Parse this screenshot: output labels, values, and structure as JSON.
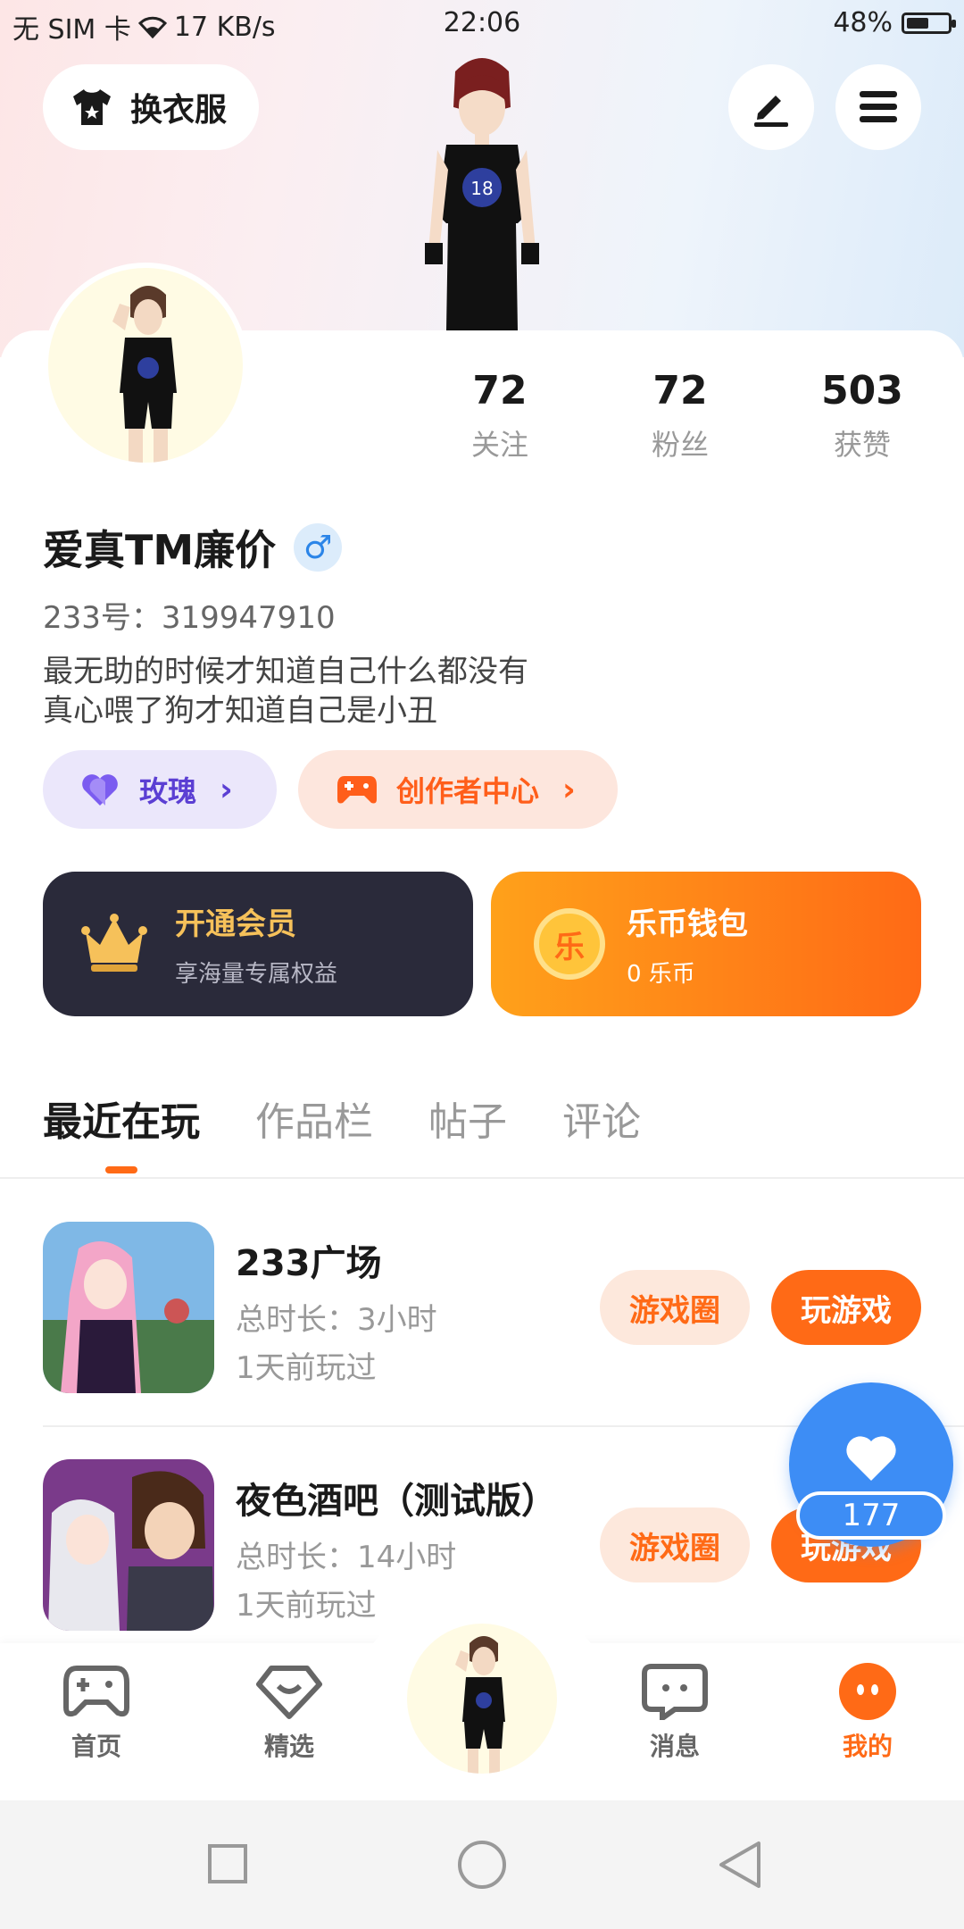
{
  "status_bar": {
    "carrier": "无 SIM 卡",
    "speed": "17 KB/s",
    "time": "22:06",
    "battery": "48%",
    "battery_level": 0.48
  },
  "header": {
    "outfit_label": "换衣服",
    "edit_icon": "pen-icon",
    "menu_icon": "menu-icon"
  },
  "profile": {
    "username": "爱真TM廉价",
    "gender_symbol": "♂",
    "uid": "233号：319947910",
    "bio_line1": "最无助的时候才知道自己什么都没有",
    "bio_line2": "真心喂了狗才知道自己是小丑",
    "stats": [
      {
        "value": "72",
        "label": "关注"
      },
      {
        "value": "72",
        "label": "粉丝"
      },
      {
        "value": "503",
        "label": "获赞"
      }
    ]
  },
  "tags": {
    "rose_label": "玫瑰",
    "creator_label": "创作者中心"
  },
  "cards": {
    "vip_title": "开通会员",
    "vip_sub": "享海量专属权益",
    "wallet_title": "乐币钱包",
    "wallet_sub": "0 乐币",
    "coin_glyph": "乐"
  },
  "tabs": [
    "最近在玩",
    "作品栏",
    "帖子",
    "评论"
  ],
  "games": [
    {
      "name": "233广场",
      "duration": "总时长：3小时",
      "last_played": "1天前玩过",
      "circle_label": "游戏圈",
      "play_label": "玩游戏"
    },
    {
      "name": "夜色酒吧（测试版）",
      "duration": "总时长：14小时",
      "last_played": "1天前玩过",
      "circle_label": "游戏圈",
      "play_label": "玩游戏"
    }
  ],
  "float_like": {
    "count": "177"
  },
  "bottom_nav": [
    {
      "label": "首页",
      "icon": "gamepad-icon"
    },
    {
      "label": "精选",
      "icon": "heart-diamond-icon"
    },
    {
      "label": "消息",
      "icon": "message-icon"
    },
    {
      "label": "我的",
      "icon": "profile-face-icon"
    }
  ],
  "colors": {
    "accent": "#ff6a16",
    "blue": "#3d8df5",
    "dark_card": "#2a2a3a"
  }
}
